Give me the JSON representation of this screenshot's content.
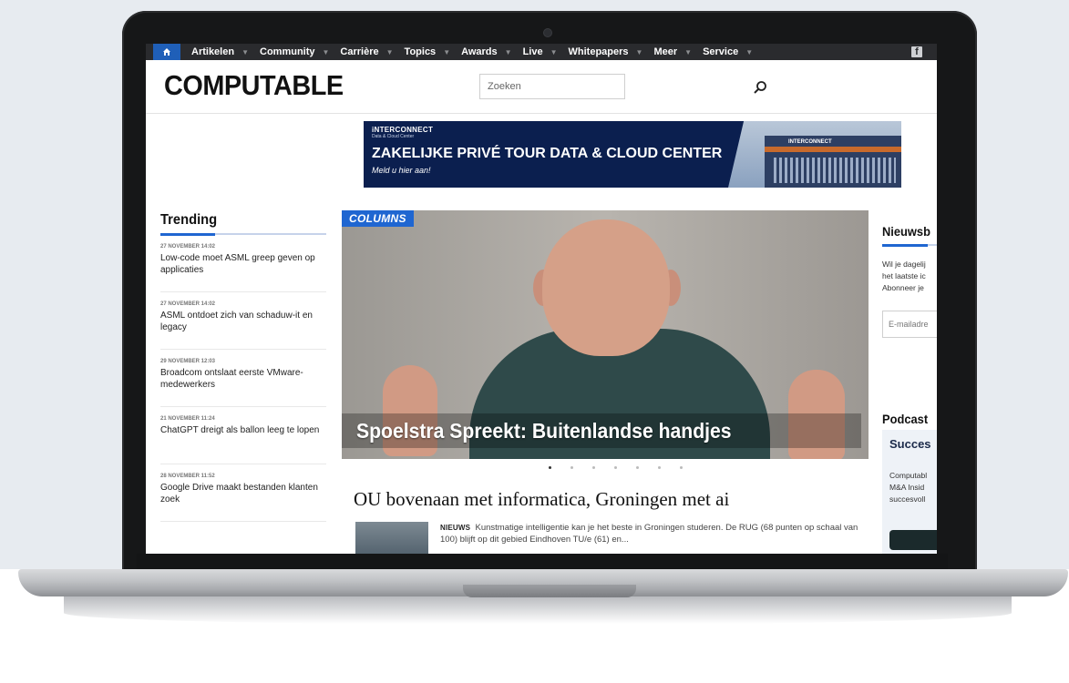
{
  "nav": {
    "items": [
      "Artikelen",
      "Community",
      "Carrière",
      "Topics",
      "Awards",
      "Live",
      "Whitepapers",
      "Meer",
      "Service"
    ]
  },
  "header": {
    "logo": "COMPUTABLE",
    "search_placeholder": "Zoeken"
  },
  "banner": {
    "brand": "iNTERCONNECT",
    "brand_sub": "Data & Cloud Center",
    "headline": "ZAKELIJKE PRIVÉ TOUR DATA & CLOUD CENTER",
    "cta": "Meld u hier aan!",
    "building_name": "INTERCONNECT"
  },
  "trending": {
    "title": "Trending",
    "items": [
      {
        "date": "27 NOVEMBER 14:02",
        "title": "Low-code moet ASML greep geven op applicaties"
      },
      {
        "date": "27 NOVEMBER 14:02",
        "title": "ASML ontdoet zich van schaduw-it en legacy"
      },
      {
        "date": "29 NOVEMBER 12:03",
        "title": "Broadcom ontslaat eerste VMware-medewerkers"
      },
      {
        "date": "21 NOVEMBER 11:24",
        "title": "ChatGPT dreigt als ballon leeg te lopen"
      },
      {
        "date": "28 NOVEMBER 11:52",
        "title": "Google Drive maakt bestanden klanten zoek"
      }
    ]
  },
  "hero": {
    "tag": "COLUMNS",
    "caption": "Spoelstra Spreekt: Buitenlandse handjes"
  },
  "article": {
    "title": "OU bovenaan met informatica, Groningen met ai",
    "label": "NIEUWS",
    "excerpt": "Kunstmatige intelligentie kan je het beste in Groningen studeren. De RUG (68 punten op schaal van 100) blijft op dit gebied Eindhoven TU/e (61) en..."
  },
  "right": {
    "newsletter_title": "Nieuwsb",
    "intro_lines": [
      "Wil je dagelij",
      "het laatste ic",
      "Abonneer je"
    ],
    "email_placeholder": "E-mailadre",
    "podcast_title": "Podcast",
    "podcast_card_title": "Succes",
    "podcast_lines": [
      "Computabl",
      "M&A Insid",
      "succesvoll"
    ]
  },
  "colors": {
    "accent": "#1f66d1",
    "nav_bg": "#2a2b2e",
    "banner_bg": "#0b1f4f"
  }
}
